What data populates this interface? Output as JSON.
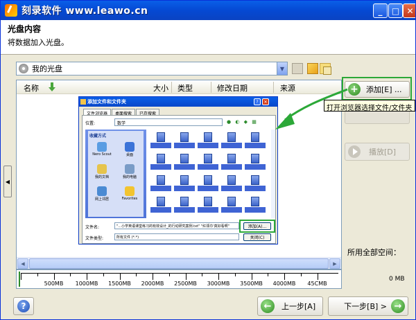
{
  "window": {
    "title": "刻录软件 www.leawo.cn"
  },
  "header": {
    "title": "光盘内容",
    "subtitle": "将数据加入光盘。"
  },
  "disc_select": {
    "value": "我的光盘"
  },
  "columns": [
    "名称",
    "大小",
    "类型",
    "修改日期",
    "来源"
  ],
  "add_button": {
    "label": "添加[E] ..."
  },
  "tooltip": "打开浏览器选择文件/文件夹",
  "play_button": {
    "label": "播放[D]"
  },
  "space": {
    "label": "所用全部空间：",
    "value": "0 MB"
  },
  "capacity_ticks": [
    "500MB",
    "1000MB",
    "1500MB",
    "2000MB",
    "2500MB",
    "3000MB",
    "3500MB",
    "4000MB",
    "45CMB"
  ],
  "nav": {
    "prev": "上一步[A]",
    "next": "下一步[B] >"
  },
  "dialog": {
    "title": "添加文件和文件夹",
    "tabs": [
      "文件浏览器",
      "桌面搜索",
      "已存搜索"
    ],
    "location_label": "位置:",
    "location_value": "数学",
    "fav_header": "收藏方式",
    "favorites": [
      "Nero Scout",
      "桌面",
      "我的文档",
      "我的电脑",
      "网上邻居",
      "Favorites"
    ],
    "files_label": "文件名:",
    "files_value": "\"...小学英语课堂练习的有效设计_的行动研究案例.txt\" \"红领巾'真好看啊\"",
    "type_label": "文件类型:",
    "type_value": "所有文件 (*.*)",
    "add_button": "添加(A)...",
    "close_button": "关闭(C)"
  },
  "colors": {
    "highlight": "#2ca838",
    "titlebar": "#0549d3"
  }
}
